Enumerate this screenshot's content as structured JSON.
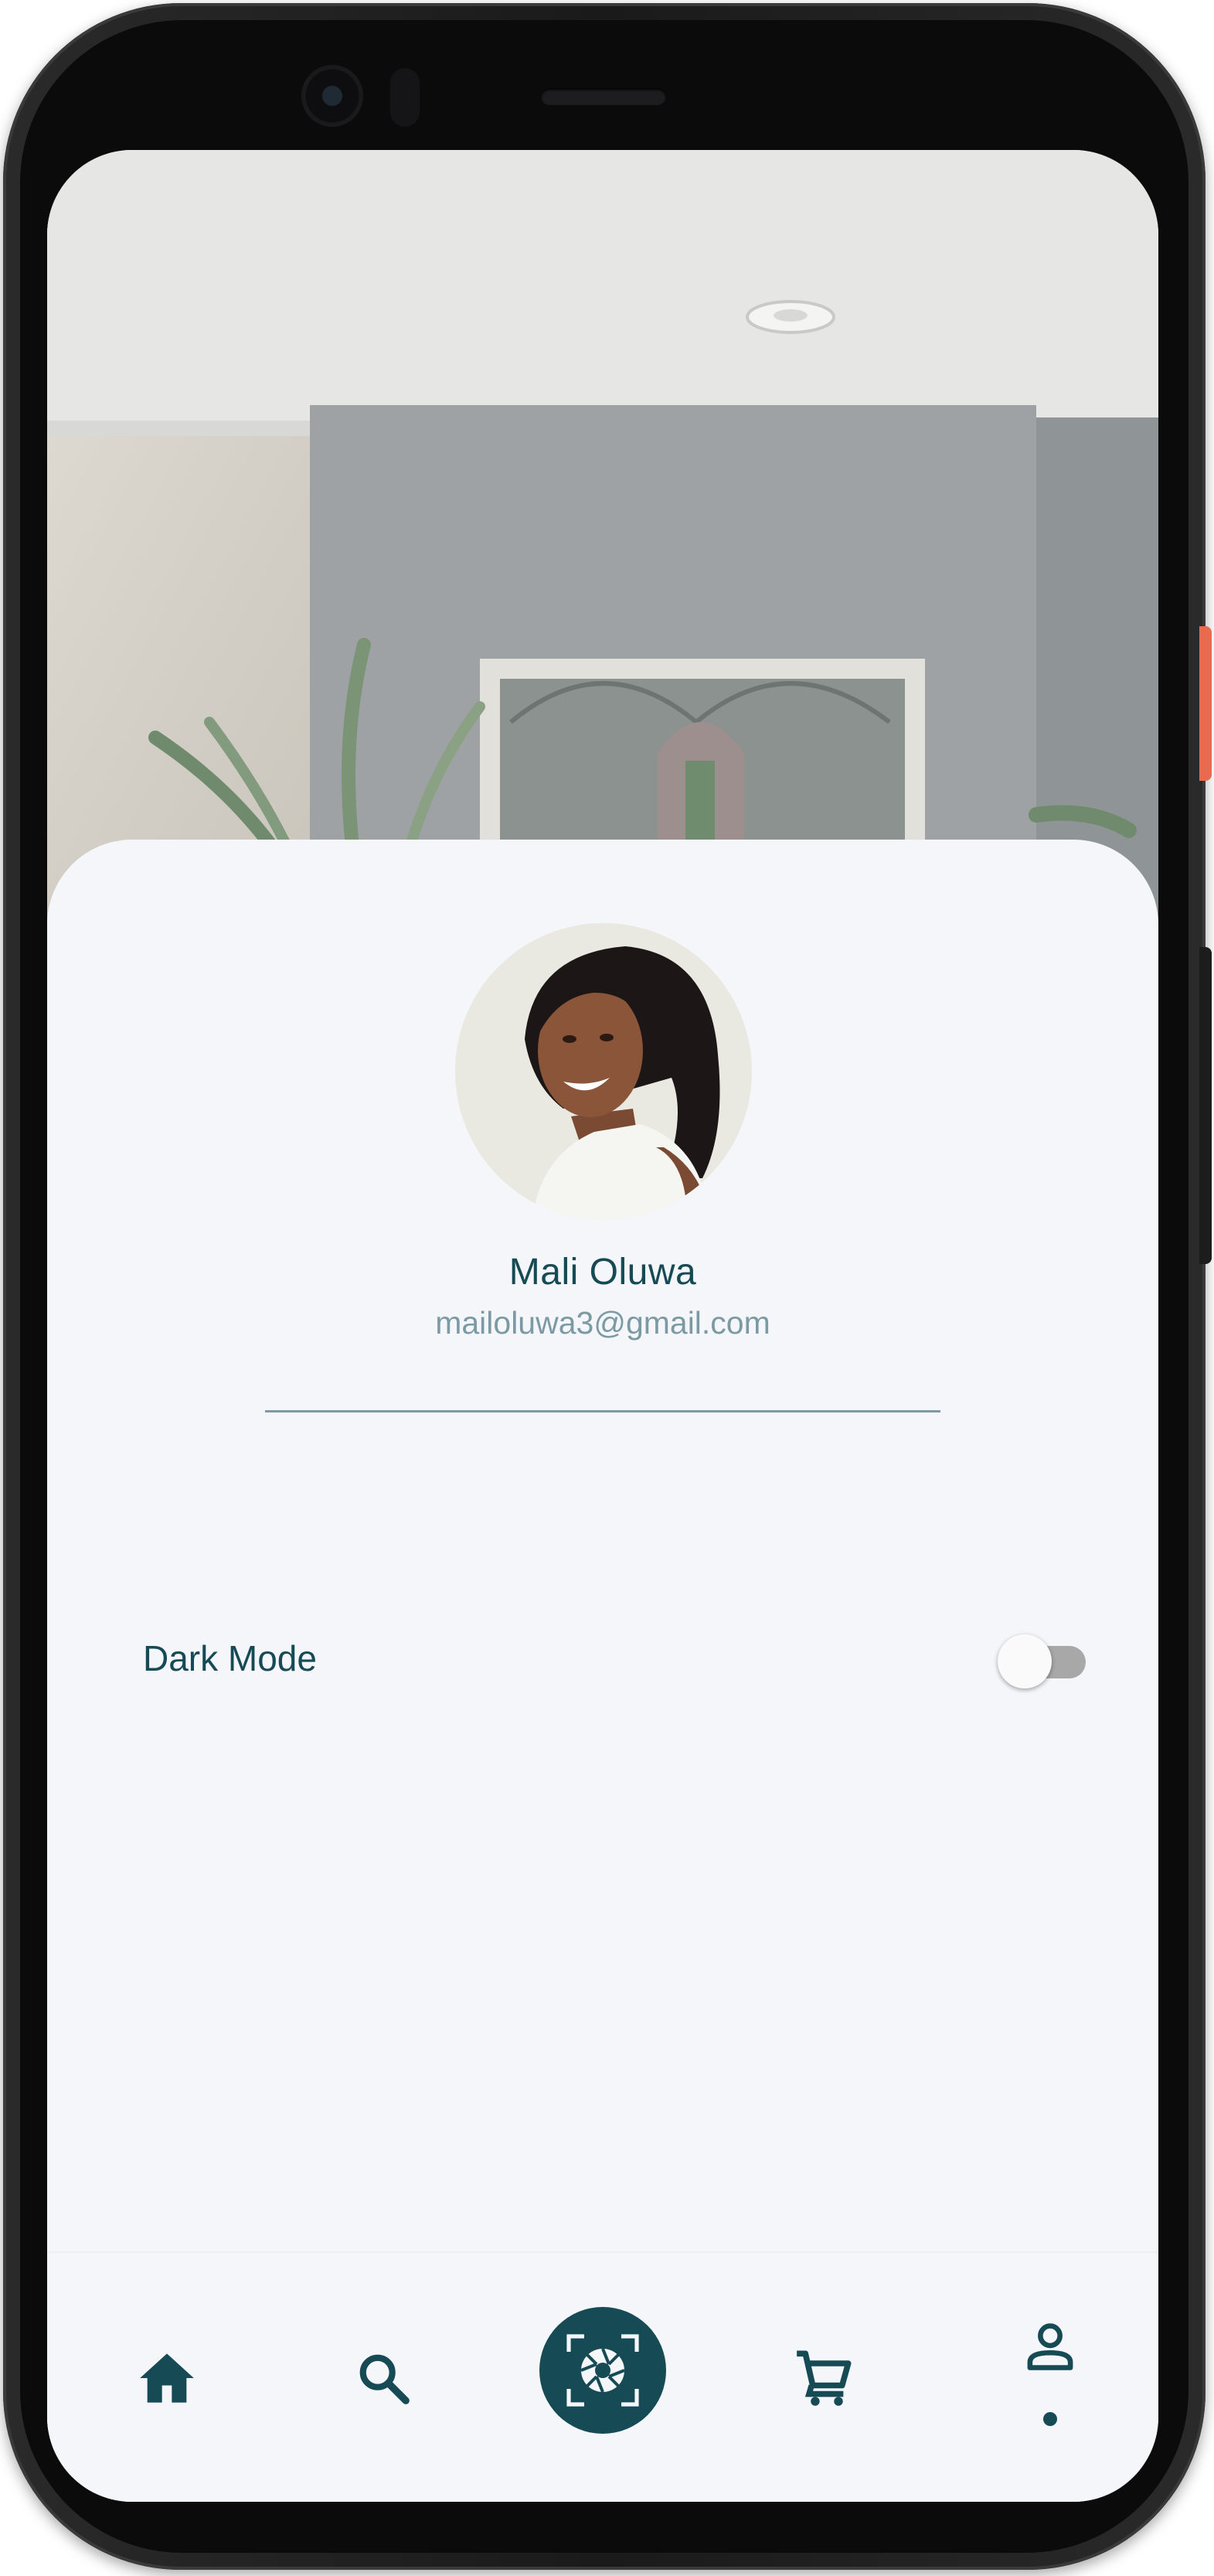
{
  "profile": {
    "name": "Mali Oluwa",
    "email": "mailoluwa3@gmail.com"
  },
  "settings": {
    "dark_mode": {
      "label": "Dark Mode",
      "enabled": false
    }
  },
  "bottom_nav": {
    "items": [
      {
        "id": "home",
        "icon": "home-icon"
      },
      {
        "id": "search",
        "icon": "search-icon"
      },
      {
        "id": "camera",
        "icon": "camera-aperture-icon"
      },
      {
        "id": "cart",
        "icon": "cart-icon"
      },
      {
        "id": "profile",
        "icon": "profile-icon",
        "active": true
      }
    ]
  },
  "colors": {
    "primary": "#164a55",
    "secondary_text": "#7c9aa3",
    "sheet_background": "#f4f6fa",
    "phone_accent_button": "#e86a4f"
  }
}
